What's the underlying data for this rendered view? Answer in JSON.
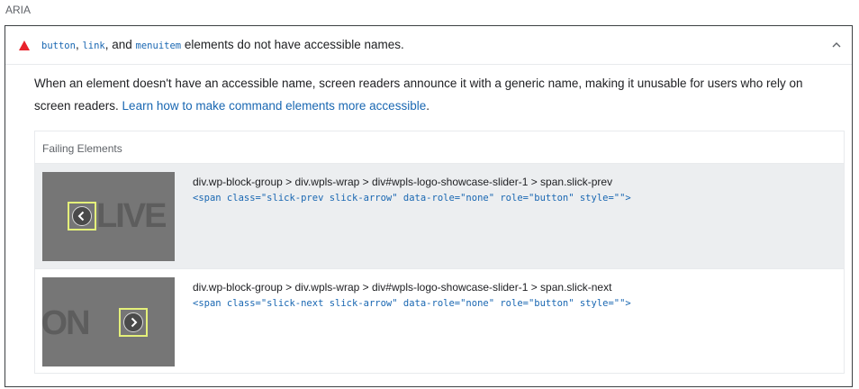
{
  "section": {
    "label": "ARIA"
  },
  "audit": {
    "title_code_1": "button",
    "title_sep_1": ", ",
    "title_code_2": "link",
    "title_sep_2": ", and ",
    "title_code_3": "menuitem",
    "title_rest": " elements do not have accessible names.",
    "status_color": "#e8222b",
    "description_text": "When an element doesn't have an accessible name, screen readers announce it with a generic name, making it unusable for users who rely on screen readers. ",
    "learn_more_label": "Learn how to make command elements more accessible",
    "description_end": "."
  },
  "failing_elements": {
    "header": "Failing Elements",
    "rows": [
      {
        "thumb_text": "LIVE",
        "selector": "div.wp-block-group > div.wpls-wrap > div#wpls-logo-showcase-slider-1 > span.slick-prev",
        "snippet": "<span class=\"slick-prev slick-arrow\" data-role=\"none\" role=\"button\" style=\"\">"
      },
      {
        "thumb_text": "ION",
        "selector": "div.wp-block-group > div.wpls-wrap > div#wpls-logo-showcase-slider-1 > span.slick-next",
        "snippet": "<span class=\"slick-next slick-arrow\" data-role=\"none\" role=\"button\" style=\"\">"
      }
    ]
  },
  "icons": {
    "status": "fail-triangle-icon",
    "toggle": "chevron-up-icon",
    "prev": "chevron-left-icon",
    "next": "chevron-right-icon"
  },
  "colors": {
    "link": "#1967b2",
    "highlight": "#e4f07a",
    "row_shade": "#eceef0"
  }
}
